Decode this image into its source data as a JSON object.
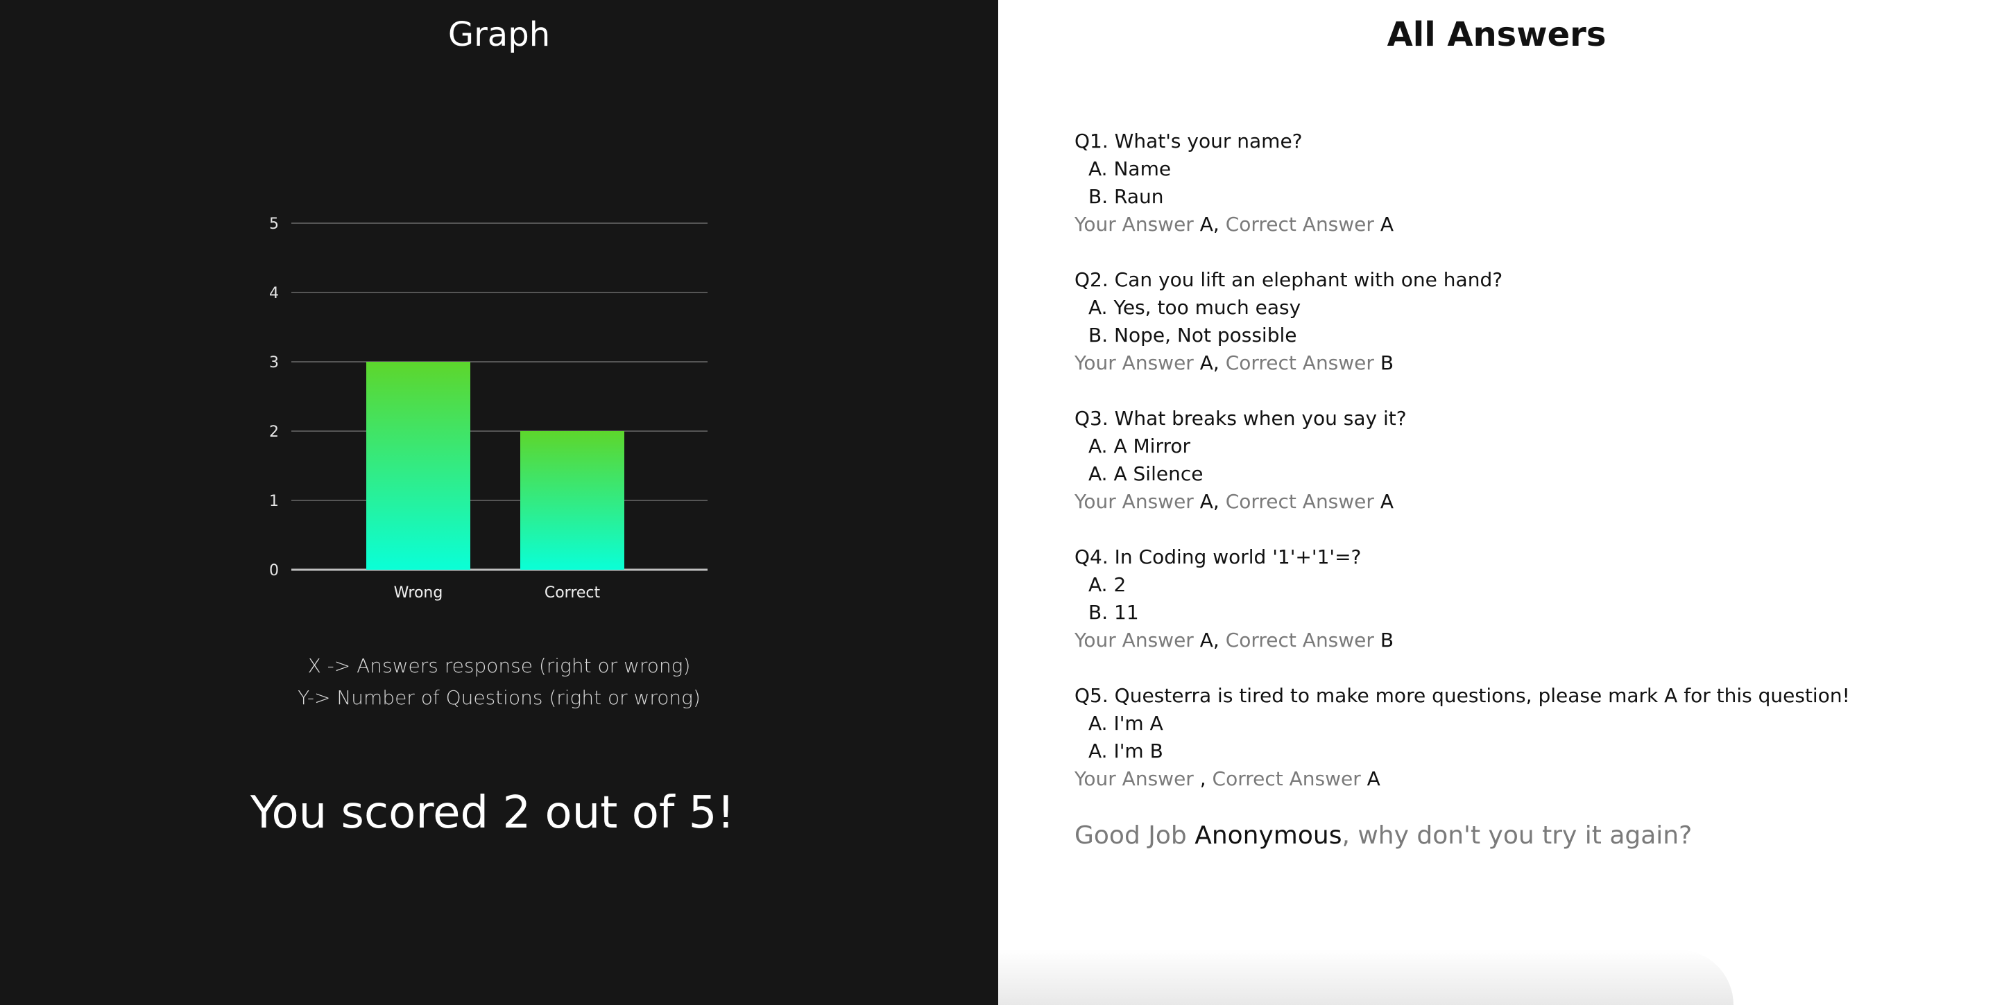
{
  "left": {
    "title": "Graph",
    "caption_x": "X -> Answers response (right or wrong)",
    "caption_y": "Y-> Number of Questions (right or wrong)",
    "score_text": "You scored 2 out of 5!"
  },
  "chart_data": {
    "type": "bar",
    "categories": [
      "Wrong",
      "Correct"
    ],
    "values": [
      3,
      2
    ],
    "ylim": [
      0,
      5
    ],
    "yticks": [
      "0",
      "1",
      "2",
      "3",
      "4",
      "5"
    ],
    "grid": true,
    "bar_gradient": {
      "top": "#5dd62c",
      "bottom": "#0affd7"
    }
  },
  "right": {
    "title": "All Answers",
    "your_answer_label": "Your Answer",
    "correct_answer_label": "Correct Answer",
    "questions": [
      {
        "text": "Q1. What's your name?",
        "options": [
          "A. Name",
          "B. Raun"
        ],
        "your_answer": "A,",
        "correct_answer": "A"
      },
      {
        "text": "Q2. Can you lift an elephant with one hand?",
        "options": [
          "A. Yes, too much easy",
          "B. Nope, Not possible"
        ],
        "your_answer": "A,",
        "correct_answer": "B"
      },
      {
        "text": "Q3. What breaks when you say it?",
        "options": [
          "A. A Mirror",
          "A. A Silence"
        ],
        "your_answer": "A,",
        "correct_answer": "A"
      },
      {
        "text": "Q4. In Coding world '1'+'1'=?",
        "options": [
          "A. 2",
          "B. 11"
        ],
        "your_answer": "A,",
        "correct_answer": "B"
      },
      {
        "text": "Q5. Questerra is tired to make more questions, please mark A for this question!",
        "options": [
          "A. I'm A",
          "A. I'm B"
        ],
        "your_answer": ",",
        "correct_answer": "A"
      }
    ],
    "goodjob_prefix": "Good Job",
    "goodjob_name": "Anonymous",
    "goodjob_suffix": ", why don't you try it again?"
  }
}
